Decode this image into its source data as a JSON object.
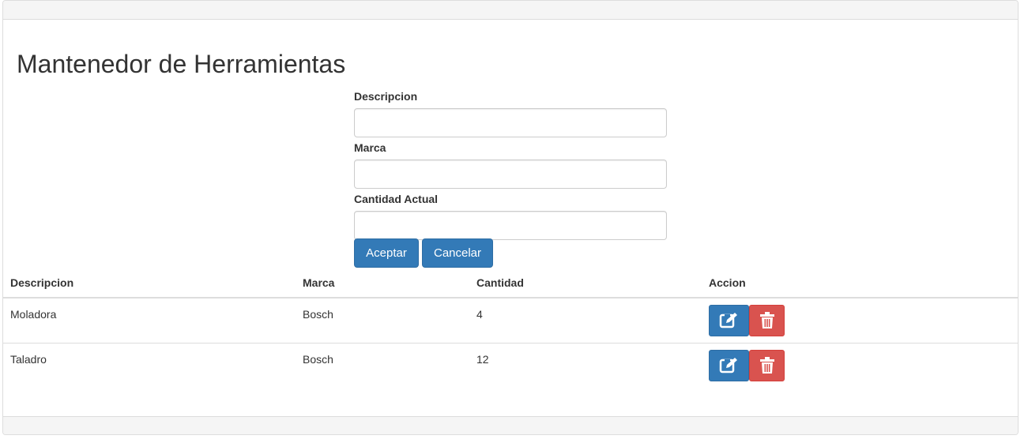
{
  "page": {
    "title": "Mantenedor de Herramientas"
  },
  "form": {
    "fields": [
      {
        "label": "Descripcion",
        "value": ""
      },
      {
        "label": "Marca",
        "value": ""
      },
      {
        "label": "Cantidad Actual",
        "value": ""
      }
    ],
    "accept_label": "Aceptar",
    "cancel_label": "Cancelar"
  },
  "table": {
    "headers": [
      "Descripcion",
      "Marca",
      "Cantidad",
      "Accion"
    ],
    "rows": [
      {
        "descripcion": "Moladora",
        "marca": "Bosch",
        "cantidad": "4",
        "actions": [
          "edit-icon",
          "trash-icon"
        ]
      },
      {
        "descripcion": "Taladro",
        "marca": "Bosch",
        "cantidad": "12",
        "actions": [
          "edit-icon",
          "trash-icon"
        ]
      }
    ]
  },
  "colors": {
    "primary": "#337ab7",
    "danger": "#d9534f",
    "panel_heading": "#f5f5f5",
    "border": "#dddddd",
    "text": "#333333"
  }
}
